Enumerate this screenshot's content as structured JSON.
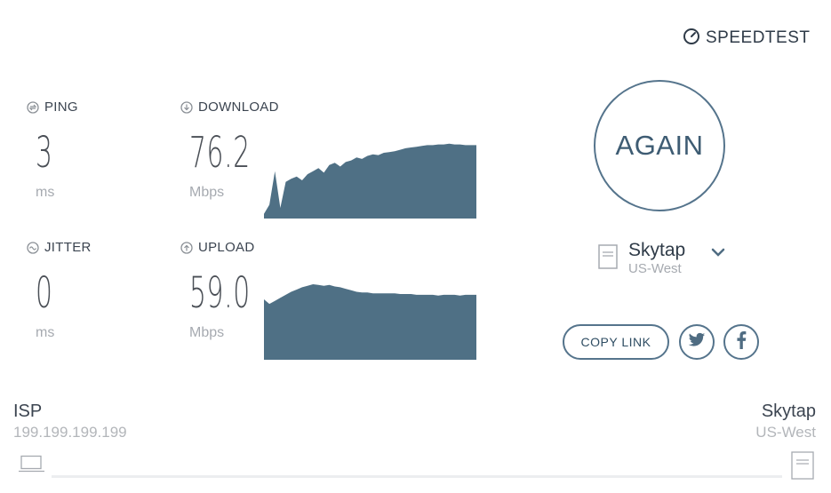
{
  "brand": {
    "name": "SPEEDTEST",
    "icon": "gauge-icon"
  },
  "metrics": {
    "ping": {
      "label": "PING",
      "value": "3",
      "unit": "ms",
      "icon": "ping-icon"
    },
    "jitter": {
      "label": "JITTER",
      "value": "0",
      "unit": "ms",
      "icon": "jitter-icon"
    },
    "download": {
      "label": "DOWNLOAD",
      "value": "76.2",
      "unit": "Mbps",
      "icon": "download-arrow-icon"
    },
    "upload": {
      "label": "UPLOAD",
      "value": "59.0",
      "unit": "Mbps",
      "icon": "upload-arrow-icon"
    }
  },
  "chart_data": [
    {
      "type": "area",
      "title": "",
      "series": [
        {
          "values": [
            0.06,
            0.18,
            0.62,
            0.14,
            0.48,
            0.52,
            0.55,
            0.5,
            0.58,
            0.62,
            0.66,
            0.6,
            0.7,
            0.73,
            0.68,
            0.74,
            0.76,
            0.8,
            0.78,
            0.82,
            0.84,
            0.83,
            0.86,
            0.87,
            0.88,
            0.9,
            0.92,
            0.93,
            0.94,
            0.95,
            0.96,
            0.96,
            0.97,
            0.97,
            0.98,
            0.97,
            0.97,
            0.96,
            0.96,
            0.96
          ]
        }
      ],
      "ylim": [
        0,
        1
      ]
    },
    {
      "type": "area",
      "title": "",
      "series": [
        {
          "values": [
            0.8,
            0.74,
            0.78,
            0.82,
            0.86,
            0.9,
            0.93,
            0.96,
            0.98,
            1.0,
            0.99,
            0.98,
            0.99,
            0.97,
            0.96,
            0.94,
            0.92,
            0.9,
            0.89,
            0.89,
            0.88,
            0.88,
            0.88,
            0.88,
            0.88,
            0.87,
            0.87,
            0.87,
            0.86,
            0.86,
            0.86,
            0.86,
            0.85,
            0.86,
            0.86,
            0.86,
            0.85,
            0.86,
            0.86,
            0.86
          ]
        }
      ],
      "ylim": [
        0,
        1
      ]
    }
  ],
  "actions": {
    "again": "AGAIN",
    "copy_link": "COPY LINK"
  },
  "server": {
    "name": "Skytap",
    "location": "US-West"
  },
  "social": {
    "twitter_icon": "twitter-icon",
    "facebook_icon": "facebook-icon"
  },
  "footer": {
    "isp_label": "ISP",
    "isp_ip": "199.199.199.199",
    "host_name": "Skytap",
    "host_location": "US-West"
  },
  "colors": {
    "accent": "#55748c",
    "chart_fill": "#4f7085",
    "text_dark": "#2f3b48",
    "text_muted": "#a6aab0"
  }
}
